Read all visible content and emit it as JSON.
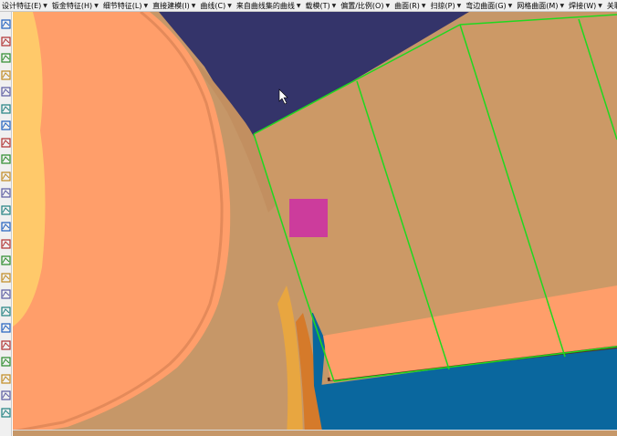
{
  "menubar": {
    "items": [
      {
        "label": "设计特征(E)"
      },
      {
        "label": "钣金特征(H)"
      },
      {
        "label": "细节特征(L)"
      },
      {
        "label": "直接建模(I)"
      },
      {
        "label": "曲线(C)"
      },
      {
        "label": "来自曲线集的曲线"
      },
      {
        "label": "载模(T)"
      },
      {
        "label": "偏置/比例(O)"
      },
      {
        "label": "曲面(R)"
      },
      {
        "label": "扫掠(P)"
      },
      {
        "label": "弯边曲面(G)"
      },
      {
        "label": "网格曲面(M)"
      },
      {
        "label": "焊接(W)"
      },
      {
        "label": "关联复制(A)"
      }
    ]
  },
  "left_toolbar": {
    "icons": [
      "select-icon",
      "measure-icon",
      "snap-point-icon",
      "curve-icon",
      "point-icon",
      "pen-icon",
      "edit-icon",
      "sketch-icon",
      "axis-icon",
      "angle-icon",
      "extrude-icon",
      "blue-solid-icon",
      "revolve-icon",
      "sweep-icon",
      "face-icon",
      "shell-icon",
      "datum-icon",
      "rotate-icon",
      "pattern-icon",
      "bookmark-icon",
      "gear-icon",
      "paint-icon",
      "layer-icon",
      "info-icon"
    ]
  },
  "viewport": {
    "background_color": "#c69768",
    "colors": {
      "navy_region": "#34346a",
      "salmon_surface": "#ff9e6a",
      "yellow_surface": "#ffc96a",
      "tan_surface": "#cc9966",
      "blue_surface": "#0a679e",
      "magenta_marker": "#cc3c9c",
      "edge_lines": "#1fd81f",
      "dark_edge": "#5a2e1e",
      "orange_strip": "#d57a2a"
    }
  }
}
